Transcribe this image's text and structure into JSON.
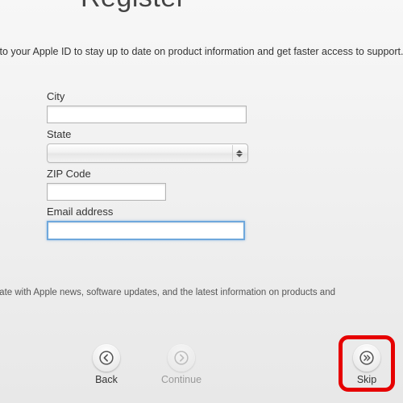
{
  "title": "Register",
  "subtitle_line": "to your Apple ID to stay up to date on product information and get faster access to support.",
  "form": {
    "city": {
      "label": "City",
      "value": ""
    },
    "state": {
      "label": "State",
      "value": ""
    },
    "zip": {
      "label": "ZIP Code",
      "value": ""
    },
    "email": {
      "label": "Email address",
      "value": ""
    }
  },
  "footer_text": "to date with Apple news, software updates, and the latest information on products and",
  "buttons": {
    "back": "Back",
    "continue": "Continue",
    "skip": "Skip"
  },
  "colors": {
    "highlight": "#e60000",
    "focus_ring": "#6fa8dc"
  }
}
